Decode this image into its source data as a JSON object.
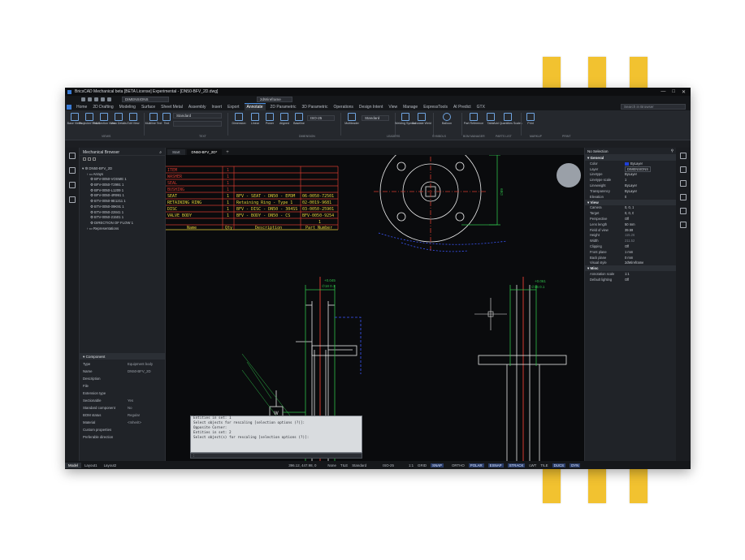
{
  "window": {
    "title": "BricsCAD Mechanical beta [BETA License] Experimental - [DN50-BFV_2D.dwg]",
    "controls": [
      "—",
      "□",
      "✕"
    ]
  },
  "quick_access": {
    "workspace": "DIMENSIONS",
    "visual_style": "2dWireframe"
  },
  "ribbon_tabs": [
    "Home",
    "2D Drafting",
    "Modeling",
    "Surface",
    "Sheet Metal",
    "Assembly",
    "Insert",
    "Export",
    "Annotate",
    "2D Parametric",
    "3D Parametric",
    "Operations",
    "Design Intent",
    "View",
    "Manage",
    "ExpressTools",
    "AI Predict",
    "GTX"
  ],
  "active_tab": "Annotate",
  "search_placeholder": "Search in Browser",
  "ribbon_buttons": [
    "Base Views",
    "Projected Views",
    "Full Section View",
    "View Details",
    "Edit View",
    "Multiline Text",
    "Text",
    "Dimension",
    "Linear",
    "Power",
    "Aligned",
    "Baseline",
    "Multileader",
    "Welding Symbol",
    "Annotate Weld",
    "Balloon",
    "Part Reference",
    "Table",
    "Add Quantities Scales",
    "Print"
  ],
  "ribbon_combos": {
    "text_style": "Standard",
    "dim_style": "ISO-25",
    "leader_style": "Standard"
  },
  "ribbon_groups": [
    "VIEWS",
    "TEXT",
    "DIMENSION",
    "LEADERS",
    "SYMBOLS",
    "BOM MANAGER",
    "PARTS LIST",
    "MARKUP",
    "PRINT"
  ],
  "browser": {
    "title": "Mechanical Browser",
    "root": "DN50-BFV_2D",
    "nodes": [
      "Arrays",
      "BFV-0050-VOSME 1",
      "BFV-0050-T2991 1",
      "BFV-0050-L1209 1",
      "BFV-0050-4R991 1",
      "BTV-0050-9E1211 1",
      "BTV-0050-09K91 1",
      "BTV-0050-22841 1",
      "BTV-0050-21501 1",
      "DIRECTION OF FLOW 1",
      "Representations"
    ]
  },
  "component": {
    "title": "Component",
    "rows": [
      {
        "k": "Type",
        "v": "Equipment body"
      },
      {
        "k": "Name",
        "v": "DN50-BFV_2D"
      },
      {
        "k": "Description",
        "v": ""
      },
      {
        "k": "File",
        "v": ""
      },
      {
        "k": "Extension type",
        "v": ""
      },
      {
        "k": "Sectionable",
        "v": "Yes"
      },
      {
        "k": "Standard component",
        "v": "No"
      },
      {
        "k": "BOM status",
        "v": "Regular"
      },
      {
        "k": "Material",
        "v": "<Inherit>"
      },
      {
        "k": "Custom properties",
        "v": ""
      },
      {
        "k": "Preferable direction",
        "v": ""
      }
    ]
  },
  "doc_tabs": [
    "Start",
    "DN50-BFV_2D*"
  ],
  "bom": {
    "headers": [
      "Name",
      "Qty",
      "Description",
      "Part Number"
    ],
    "rows": [
      [
        "ITEM",
        "1",
        "",
        ""
      ],
      [
        "WASHER",
        "1",
        "",
        ""
      ],
      [
        "SEAL",
        "1",
        "",
        ""
      ],
      [
        "BUSHING",
        "1",
        "",
        ""
      ],
      [
        "SEAT",
        "1",
        "BFV - SEAT - DN50 - EPDM",
        "06-0050-72501"
      ],
      [
        "RETAINING RING",
        "1",
        "Retaining Ring - Type 1",
        "02-0019-9681"
      ],
      [
        "DISC",
        "1",
        "BFV - DISC - DN50 - 304SS",
        "03-0050-25901"
      ],
      [
        "VALVE BODY",
        "1",
        "BFV - BODY - DN50 - CS",
        "BFV-0050-9254"
      ],
      [
        "",
        "",
        "",
        "1"
      ]
    ]
  },
  "drawing": {
    "dim_left": [
      "+0.045",
      "∅18 0.1"
    ],
    "dim_right": [
      "+0.061",
      "∅16 0.1"
    ],
    "dim_top": "∅85",
    "dim_vertical": "∅89",
    "weld_label": "W",
    "line_colors": {
      "outline": "#e8e8e8",
      "red": "#d23a2e",
      "green": "#2fbf4a",
      "blue": "#3b57ff",
      "yellow": "#e8d23a"
    }
  },
  "command": {
    "lines": [
      "Entities in set: 1",
      "Select objects for rescaling [selection options (?)]:",
      "Opposite Corner:",
      "Entities in set: 2",
      "Select object(s) for rescaling [selection options (?)]:"
    ],
    "prompt": ":"
  },
  "properties": {
    "selection": "No Selection",
    "sections": [
      {
        "name": "General",
        "rows": [
          [
            "Color",
            "ByLayer"
          ],
          [
            "Layer",
            "DIMENSIONS"
          ],
          [
            "Linetype",
            "ByLayer"
          ],
          [
            "Linetype scale",
            "1"
          ],
          [
            "Lineweight",
            "ByLayer"
          ],
          [
            "Transparency",
            "ByLayer"
          ],
          [
            "Elevation",
            "0"
          ]
        ]
      },
      {
        "name": "View",
        "rows": [
          [
            "Camera",
            "0, 0, 1"
          ],
          [
            "Target",
            "0, 0, 0"
          ],
          [
            "Perspective",
            "Off"
          ],
          [
            "Lens length",
            "50 mm"
          ],
          [
            "Field of view",
            "39.59"
          ],
          [
            "Height",
            "115.26"
          ],
          [
            "Width",
            "211.52"
          ],
          [
            "Clipping",
            "Off"
          ],
          [
            "Front plane",
            "1 mm"
          ],
          [
            "Back plane",
            "0 mm"
          ],
          [
            "Visual style",
            "2dWireframe"
          ]
        ]
      },
      {
        "name": "Misc",
        "rows": [
          [
            "Annotation scale",
            "1:1"
          ],
          [
            "Default lighting",
            "Off"
          ]
        ]
      }
    ]
  },
  "status": {
    "tabs": [
      "Model",
      "Layout1",
      "Layout2"
    ],
    "coords": "396.12, 447.98, 0",
    "items": [
      "None",
      "TILE",
      "Standard",
      "ISO-25",
      "1:1",
      "GRID",
      "SNAP",
      "ORTHO",
      "POLAR",
      "ESNAP",
      "STRACK",
      "LWT",
      "TILE",
      "DUCS",
      "DYN"
    ],
    "on_items": [
      "SNAP",
      "POLAR",
      "ESNAP",
      "STRACK",
      "DUCS",
      "DYN"
    ]
  }
}
